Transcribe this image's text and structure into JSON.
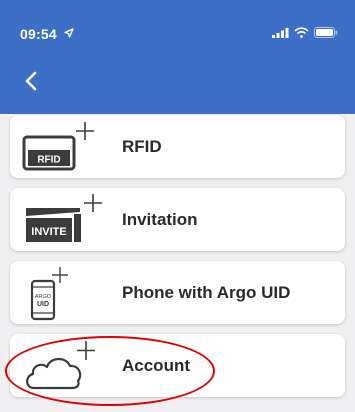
{
  "status_bar": {
    "time": "09:54",
    "location_icon": "location-arrow-icon",
    "signal_icon": "cellular-signal-icon",
    "wifi_icon": "wifi-icon",
    "battery_icon": "battery-icon"
  },
  "nav": {
    "back_icon": "chevron-left-icon"
  },
  "options": [
    {
      "label": "RFID",
      "icon": "rfid-card-add-icon",
      "icon_text": "RFID"
    },
    {
      "label": "Invitation",
      "icon": "invitation-card-add-icon",
      "icon_text": "INVITE"
    },
    {
      "label": "Phone with Argo UID",
      "icon": "phone-add-icon",
      "icon_text_line1": "ARGO",
      "icon_text_line2": "UID"
    },
    {
      "label": "Account",
      "icon": "cloud-add-icon"
    }
  ],
  "colors": {
    "header": "#3d6fc7",
    "background": "#f0f0f2",
    "card": "#ffffff",
    "icon_dark": "#3c3c3c",
    "annotation": "#e00000"
  }
}
